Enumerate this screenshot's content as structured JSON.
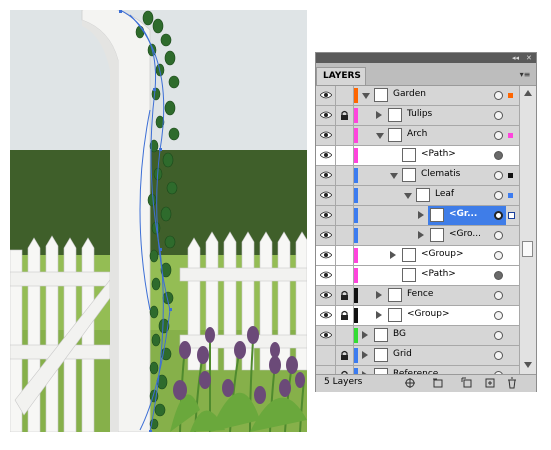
{
  "panel": {
    "tab_label": "LAYERS",
    "footer_count": "5 Layers"
  },
  "colors": {
    "row_selected": "#3f7de8",
    "row_active_bg": "#ffffff",
    "row_default_bg": "#d6d6d6"
  },
  "layers": [
    {
      "name": "Garden",
      "visible": true,
      "locked": false,
      "color": "#ff6600",
      "indent": 0,
      "expanded": true,
      "target": "hollow",
      "selmark": "#ff6600"
    },
    {
      "name": "Tulips",
      "visible": true,
      "locked": true,
      "color": "#ff44dd",
      "indent": 1,
      "expanded": false,
      "target": "hollow"
    },
    {
      "name": "Arch",
      "visible": true,
      "locked": false,
      "color": "#ff44dd",
      "indent": 1,
      "expanded": true,
      "target": "hollow",
      "selmark": "#ff44dd"
    },
    {
      "name": "<Path>",
      "visible": true,
      "locked": false,
      "color": "#ff44dd",
      "indent": 2,
      "expanded": null,
      "target": "filled",
      "active": true
    },
    {
      "name": "Clematis",
      "visible": true,
      "locked": false,
      "color": "#3c7cf0",
      "indent": 2,
      "expanded": true,
      "target": "hollow",
      "selmark": "#111111"
    },
    {
      "name": "Leaf",
      "visible": true,
      "locked": false,
      "color": "#3c7cf0",
      "indent": 3,
      "expanded": true,
      "target": "hollow",
      "selmark": "#3c7cf0"
    },
    {
      "name": "<Gr...",
      "visible": true,
      "locked": false,
      "color": "#3c7cf0",
      "indent": 4,
      "expanded": false,
      "target": "selected",
      "selected": true,
      "selmark": "#3c7cf0"
    },
    {
      "name": "<Gro...",
      "visible": true,
      "locked": false,
      "color": "#3c7cf0",
      "indent": 4,
      "expanded": false,
      "target": "hollow"
    },
    {
      "name": "<Group>",
      "visible": true,
      "locked": false,
      "color": "#ff44dd",
      "indent": 2,
      "expanded": false,
      "target": "hollow",
      "active": true
    },
    {
      "name": "<Path>",
      "visible": true,
      "locked": false,
      "color": "#ff44dd",
      "indent": 2,
      "expanded": null,
      "target": "filled",
      "active": true
    },
    {
      "name": "Fence",
      "visible": true,
      "locked": true,
      "color": "#111111",
      "indent": 1,
      "expanded": false,
      "target": "hollow"
    },
    {
      "name": "<Group>",
      "visible": true,
      "locked": true,
      "color": "#111111",
      "indent": 1,
      "expanded": false,
      "target": "hollow",
      "active": true
    },
    {
      "name": "BG",
      "visible": true,
      "locked": false,
      "color": "#33dd33",
      "indent": 0,
      "expanded": false,
      "target": "hollow"
    },
    {
      "name": "Grid",
      "visible": false,
      "locked": true,
      "color": "#3c7cf0",
      "indent": 0,
      "expanded": false,
      "target": "hollow"
    },
    {
      "name": "Reference",
      "visible": false,
      "locked": true,
      "color": "#3c7cf0",
      "indent": 0,
      "expanded": false,
      "target": "hollow"
    }
  ]
}
